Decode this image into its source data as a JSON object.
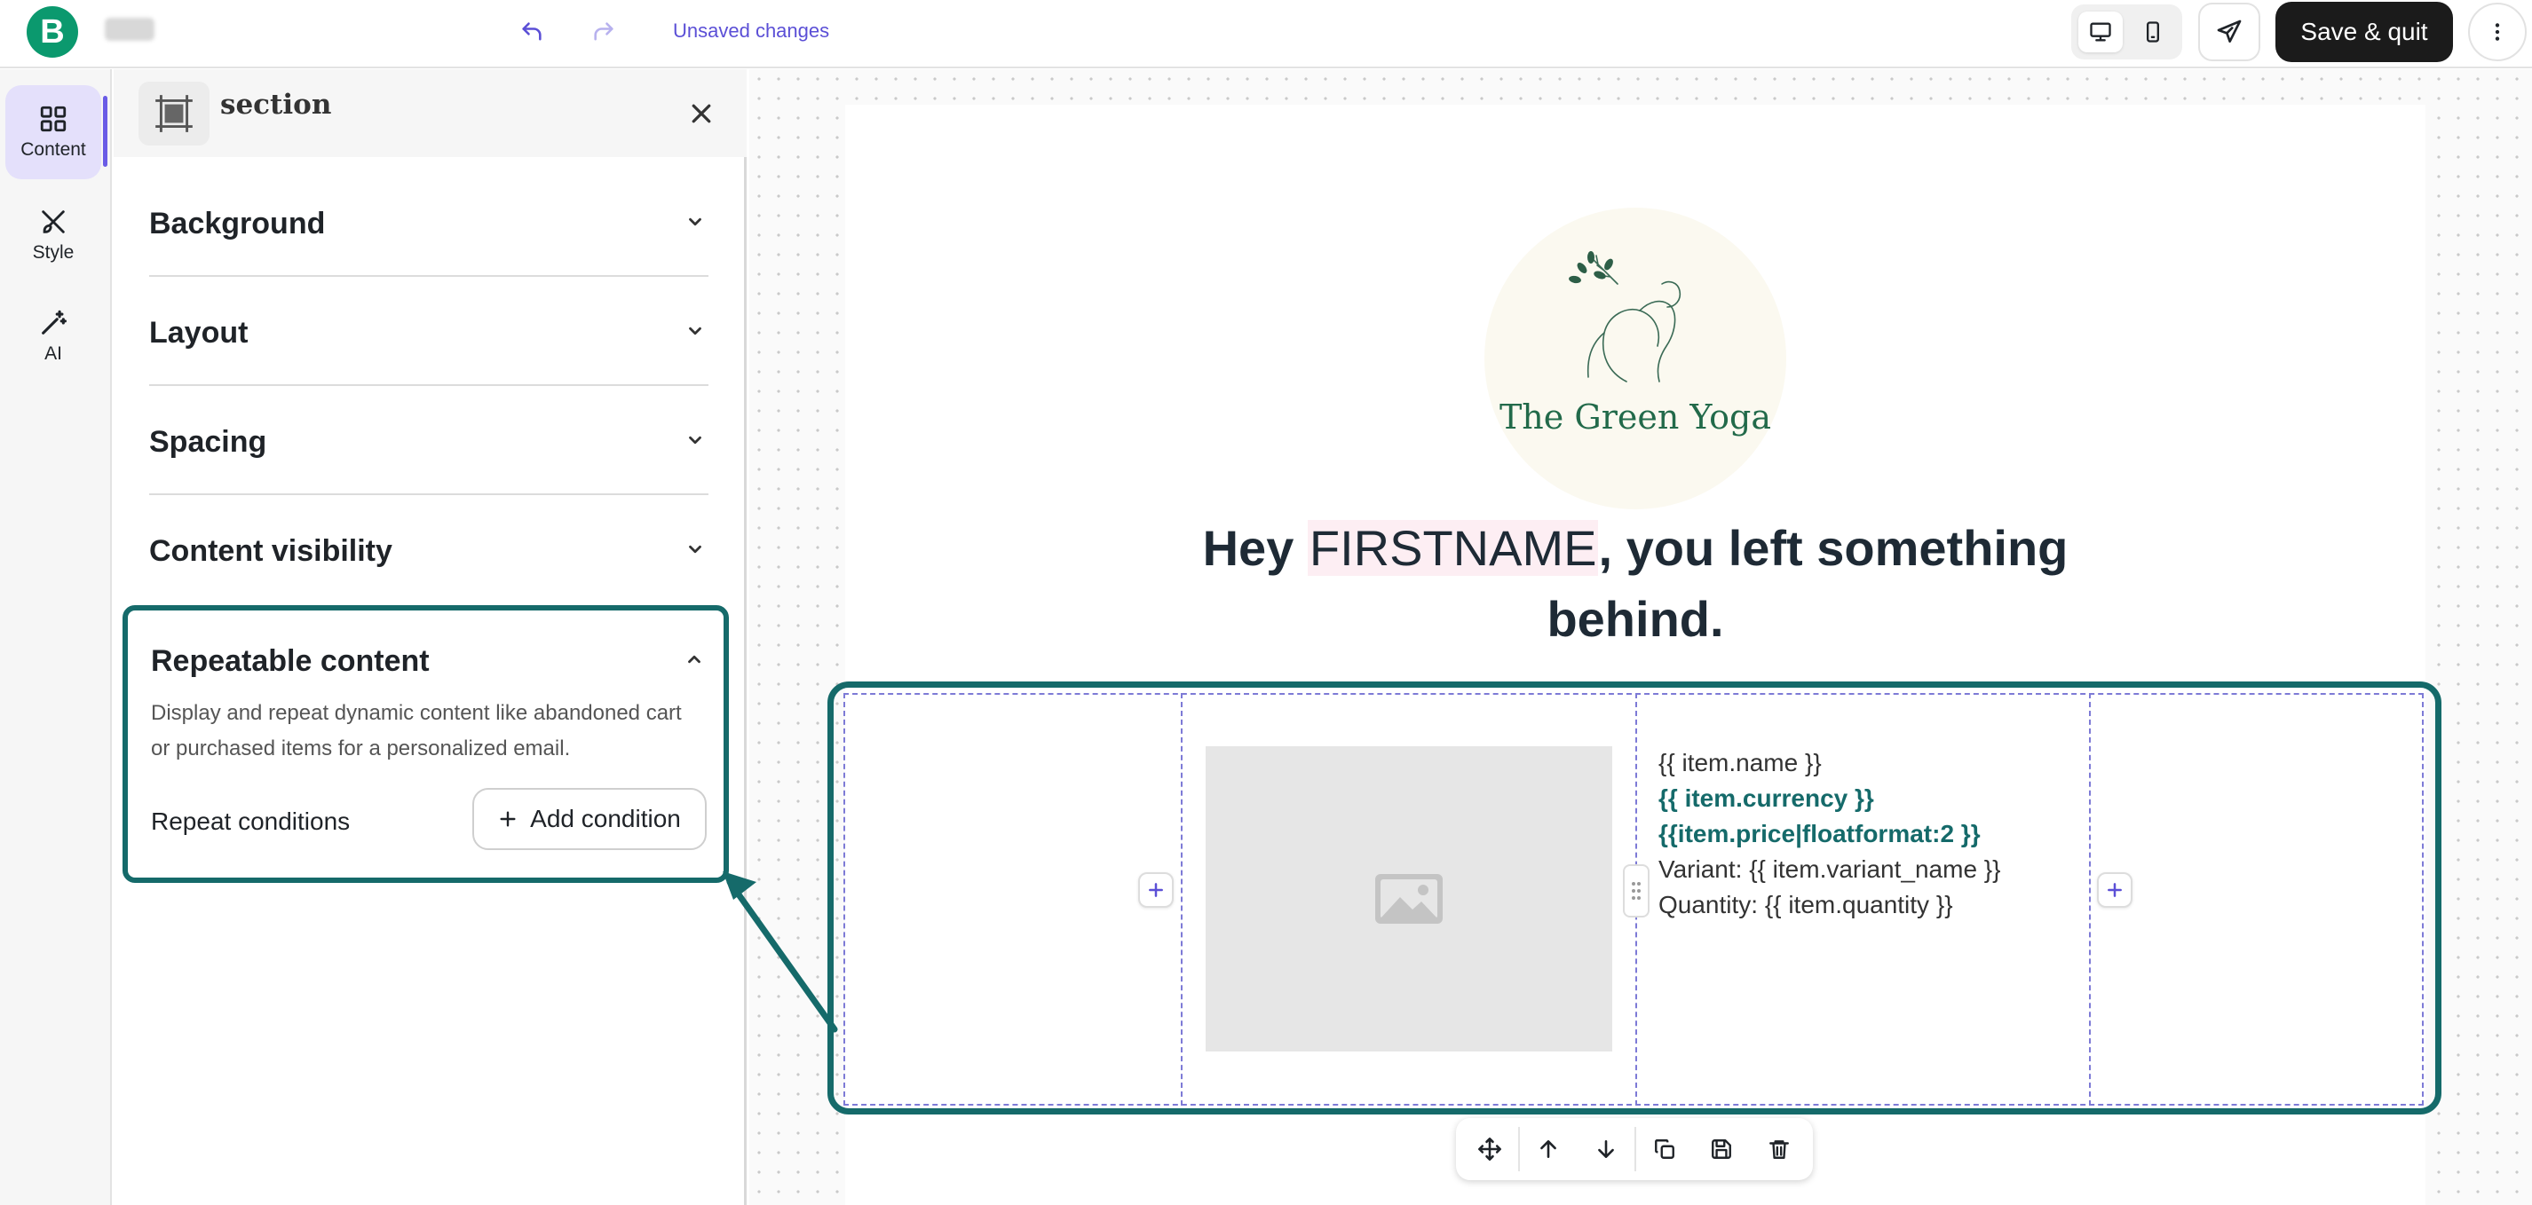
{
  "topbar": {
    "logo_letter": "B",
    "unsaved_label": "Unsaved changes",
    "save_quit_label": "Save & quit"
  },
  "rail": {
    "items": [
      {
        "label": "Content",
        "icon": "grid-icon",
        "active": true
      },
      {
        "label": "Style",
        "icon": "brush-icon",
        "active": false
      },
      {
        "label": "AI",
        "icon": "magic-wand-icon",
        "active": false
      }
    ]
  },
  "panel": {
    "title": "section",
    "accordions": [
      {
        "label": "Background"
      },
      {
        "label": "Layout"
      },
      {
        "label": "Spacing"
      },
      {
        "label": "Content visibility"
      }
    ],
    "repeatable": {
      "title": "Repeatable content",
      "description": "Display and repeat dynamic content like abandoned cart or purchased items for a personalized email.",
      "conditions_label": "Repeat conditions",
      "add_condition_label": "Add condition"
    }
  },
  "email": {
    "brand_name": "The Green Yoga",
    "headline_prefix": "Hey ",
    "headline_name": "FIRSTNAME",
    "headline_rest": ", you left something behind.",
    "item": {
      "name": "{{ item.name }}",
      "price": "{{ item.currency }} {{item.price|floatformat:2 }}",
      "variant": "Variant: {{ item.variant_name }}",
      "quantity": "Quantity: {{ item.quantity }}"
    }
  },
  "colors": {
    "accent": "#5b4fd6",
    "highlight": "#156a6a",
    "brand_green": "#0b996e",
    "dark_button": "#1b1b1b"
  }
}
